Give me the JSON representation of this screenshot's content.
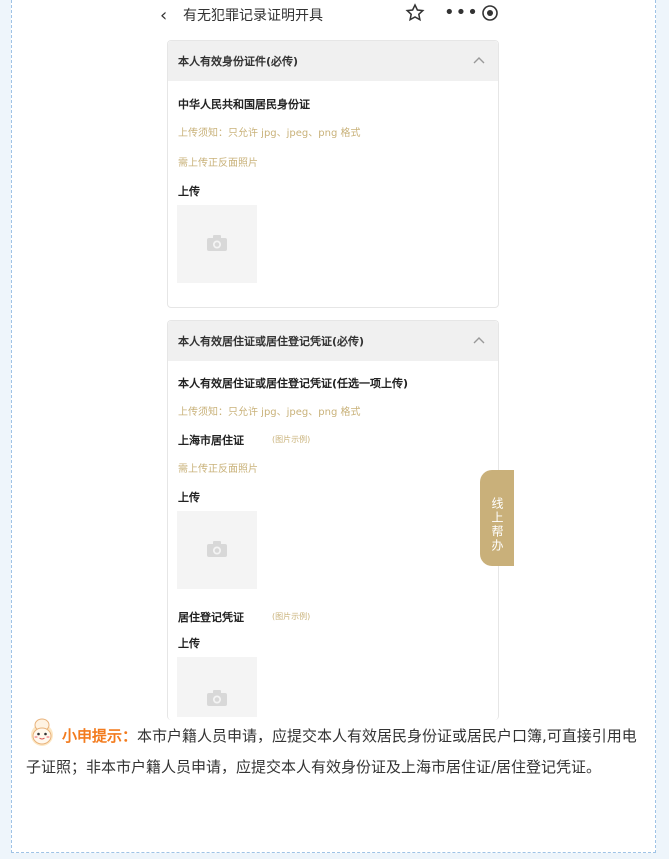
{
  "topbar": {
    "back_icon": "back-chevron-icon",
    "title": "有无犯罪记录证明开具",
    "icons": [
      "star-icon",
      "more-icon",
      "target-icon"
    ]
  },
  "card1": {
    "header": "本人有效身份证件(必传)",
    "doc_title": "中华人民共和国居民身份证",
    "hint_format": "上传须知：只允许 jpg、jpeg、png 格式",
    "hint_sides": "需上传正反面照片",
    "upload_label": "上传"
  },
  "card2": {
    "header": "本人有效居住证或居住登记凭证(必传)",
    "doc_title": "本人有效居住证或居住登记凭证(任选一项上传)",
    "hint_format": "上传须知：只允许 jpg、jpeg、png 格式",
    "sub1_title": "上海市居住证",
    "sub1_sample": "(图片示例)",
    "sub1_hint": "需上传正反面照片",
    "sub1_upload": "上传",
    "sub2_title": "居住登记凭证",
    "sub2_sample": "(图片示例)",
    "sub2_upload": "上传"
  },
  "help_tab": "线上帮办",
  "tip": {
    "label": "小申提示：",
    "text": "本市户籍人员申请，应提交本人有效居民身份证或居民户口簿,可直接引用电子证照；非本市户籍人员申请，应提交本人有效身份证及上海市居住证/居住登记凭证。"
  },
  "colors": {
    "hint": "#c9b27a",
    "help_tab": "#c9b07a",
    "tip_label": "#f37b1d",
    "frame_border": "#9fc3e6"
  }
}
